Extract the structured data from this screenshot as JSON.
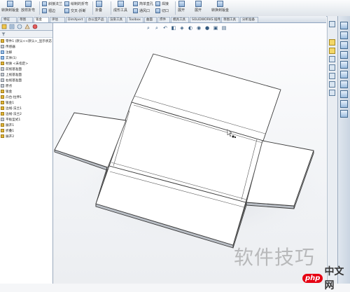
{
  "ribbon": {
    "buttons": [
      {
        "label": "转换到钣金",
        "icon": "convert-sheetmetal-icon"
      },
      {
        "label": "放样折弯",
        "icon": "lofted-bend-icon"
      },
      {
        "label": "转换到钣金",
        "icon": "convert-icon"
      }
    ],
    "small_buttons": [
      {
        "label": "斜接法兰",
        "icon": "miter-flange-icon"
      },
      {
        "label": "绘制的折弯",
        "icon": "sketched-bend-icon"
      },
      {
        "label": "褶边",
        "icon": "hem-icon"
      },
      {
        "label": "交叉-折断",
        "icon": "cross-break-icon"
      },
      {
        "label": "折叠",
        "icon": "fold-icon"
      },
      {
        "label": "展开",
        "icon": "unfold-icon"
      },
      {
        "label": "成形工具",
        "icon": "forming-tool-icon"
      },
      {
        "label": "简单直孔",
        "icon": "simple-hole-icon"
      },
      {
        "label": "通风口",
        "icon": "vent-icon"
      },
      {
        "label": "焊接",
        "icon": "weld-icon"
      },
      {
        "label": "切口",
        "icon": "rip-icon"
      },
      {
        "label": "展开",
        "icon": "flatten-icon"
      }
    ]
  },
  "tabs": [
    "特征",
    "草图",
    "钣金",
    "评估",
    "DimXpert",
    "办公室产品",
    "渲染工具",
    "Toolbox",
    "曲面",
    "焊件",
    "模具工具",
    "SOLIDWORKS 插件",
    "草图工具",
    "分析准备"
  ],
  "active_tab": "钣金",
  "tree": {
    "items": [
      {
        "label": "零件1 (默认<<默认>_显示状态 1>)",
        "icon": "part-icon"
      },
      {
        "label": "传感器",
        "icon": "sensor-icon"
      },
      {
        "label": "注解",
        "icon": "annotation-icon"
      },
      {
        "label": "实体(1)",
        "icon": "solid-body-icon"
      },
      {
        "label": "材质 <未指定>",
        "icon": "material-icon"
      },
      {
        "label": "前视基准面",
        "icon": "plane-icon"
      },
      {
        "label": "上视基准面",
        "icon": "plane-icon"
      },
      {
        "label": "右视基准面",
        "icon": "plane-icon"
      },
      {
        "label": "原点",
        "icon": "origin-icon"
      },
      {
        "label": "钣金",
        "icon": "sheetmetal-icon"
      },
      {
        "label": "凸台-拉伸1",
        "icon": "extrude-icon"
      },
      {
        "label": "钣金1",
        "icon": "sheetmetal-feature-icon"
      },
      {
        "label": "边线-法兰1",
        "icon": "edge-flange-icon"
      },
      {
        "label": "边线-法兰2",
        "icon": "edge-flange-icon"
      },
      {
        "label": "平板型式1",
        "icon": "flat-pattern-icon"
      },
      {
        "label": "展开1",
        "icon": "flatten-icon"
      },
      {
        "label": "折叠1",
        "icon": "fold-icon"
      },
      {
        "label": "展开2",
        "icon": "unfold-icon"
      }
    ]
  },
  "viewport": {
    "model": "flattened-sheetmetal-box",
    "headsup_icons": [
      "zoom-to-fit-icon",
      "zoom-area-icon",
      "previous-view-icon",
      "section-view-icon",
      "view-orientation-icon",
      "display-style-icon",
      "hide-show-icon",
      "edit-appearance-icon",
      "scene-icon",
      "view-settings-icon"
    ]
  },
  "watermark": {
    "text_cn": "软件技巧",
    "php_badge": "php",
    "php_cn": "中文网"
  },
  "colors": {
    "ribbon_bg": "#dfe4ea",
    "panel_border": "#9aa9bd",
    "model_face": "#ffffff",
    "model_edge": "#3a3a3a",
    "watermark_red": "#e60012"
  }
}
